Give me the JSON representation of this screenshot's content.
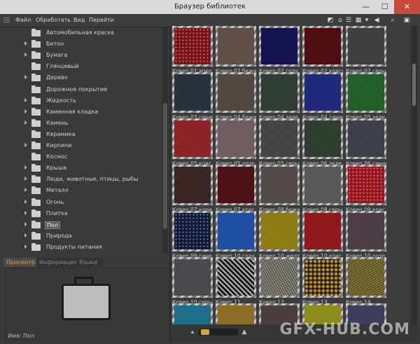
{
  "window": {
    "title": "Браузер библиотек",
    "controls": {
      "minimize": "—",
      "maximize": "☐",
      "close": "✕"
    }
  },
  "menu": [
    "Файл",
    "Обработать",
    "Вид",
    "Перейти"
  ],
  "tree": {
    "items": [
      {
        "label": "Автомобильная краска",
        "arrow": false
      },
      {
        "label": "Бетон",
        "arrow": true
      },
      {
        "label": "Бумага",
        "arrow": true
      },
      {
        "label": "Глянцевый",
        "arrow": false
      },
      {
        "label": "Дерево",
        "arrow": true
      },
      {
        "label": "Дорожное покрытие",
        "arrow": false
      },
      {
        "label": "Жидкость",
        "arrow": true
      },
      {
        "label": "Каменная кладка",
        "arrow": true
      },
      {
        "label": "Камень",
        "arrow": true
      },
      {
        "label": "Керамика",
        "arrow": false
      },
      {
        "label": "Кирпичи",
        "arrow": true
      },
      {
        "label": "Космос",
        "arrow": false
      },
      {
        "label": "Крыша",
        "arrow": true
      },
      {
        "label": "Люди, животные, птицы, рыбы",
        "arrow": true
      },
      {
        "label": "Металл",
        "arrow": true
      },
      {
        "label": "Огонь",
        "arrow": true
      },
      {
        "label": "Плитка",
        "arrow": true
      },
      {
        "label": "Пол",
        "arrow": true,
        "selected": true
      },
      {
        "label": "Природа",
        "arrow": true
      },
      {
        "label": "Продукты питания",
        "arrow": true
      }
    ]
  },
  "tabs": [
    "Просмотр",
    "Информация",
    "Языки"
  ],
  "preview": {
    "name_label": "Имя:",
    "name_value": "Пол"
  },
  "thumbnails": [
    {
      "label": "Ковер 01 арко...",
      "color": "#7a1218",
      "pattern": "dots"
    },
    {
      "label": "Ковер 02 беже...",
      "color": "#5e4d45",
      "pattern": "plain"
    },
    {
      "label": "Ковер 02 голу...",
      "color": "#0e0f4c",
      "pattern": "plain"
    },
    {
      "label": "Ковер 02 красн...",
      "color": "#4a0a0e",
      "pattern": "plain"
    },
    {
      "label": "Ковер 02 серый",
      "color": "#3c3c3c",
      "pattern": "plain"
    },
    {
      "label": "Ковер 03 синий",
      "color": "#252d3b",
      "pattern": "plain"
    },
    {
      "label": "Ковер 04 беже...",
      "color": "#4e453e",
      "pattern": "plain"
    },
    {
      "label": "Ковер 04 зеле...",
      "color": "#2c3a2e",
      "pattern": "plain"
    },
    {
      "label": "Ковер 04 синий",
      "color": "#1c2677",
      "pattern": "plain"
    },
    {
      "label": "Ковер 05 зеле...",
      "color": "#1e5c26",
      "pattern": "plain"
    },
    {
      "label": "Ковер 05 крас...",
      "color": "#8a2024",
      "pattern": "plain"
    },
    {
      "label": "Ковер 05 розо...",
      "color": "#6d5a5a",
      "pattern": "plain"
    },
    {
      "label": "Ковер 05 серый",
      "color": "#414141",
      "pattern": "plain"
    },
    {
      "label": "Ковер 06 зеле...",
      "color": "#2a3a2c",
      "pattern": "plain"
    },
    {
      "label": "Ковер 06 синий",
      "color": "#3a3d45",
      "pattern": "plain"
    },
    {
      "label": "Ковер 07 кори...",
      "color": "#352220",
      "pattern": "plain"
    },
    {
      "label": "Ковер 07 крас...",
      "color": "#4a0d12",
      "pattern": "plain"
    },
    {
      "label": "Ковер 08 беже...",
      "color": "#4f4844",
      "pattern": "plain"
    },
    {
      "label": "Ковер 08 серый",
      "color": "#555555",
      "pattern": "plain"
    },
    {
      "label": "Ковер 09 крас...",
      "color": "#9a1420",
      "pattern": "dots"
    },
    {
      "label": "Ковер 09 сине ...",
      "color": "#101a3a",
      "pattern": "dots"
    },
    {
      "label": "Ковер 10 голу...",
      "color": "#1a4aa0",
      "pattern": "plain"
    },
    {
      "label": "Ковер 10 желт...",
      "color": "#8a7a10",
      "pattern": "plain"
    },
    {
      "label": "Ковер 10 крас...",
      "color": "#8e1418",
      "pattern": "plain"
    },
    {
      "label": "Ковер 10 розо...",
      "color": "#4a3a44",
      "pattern": "plain"
    },
    {
      "label": "Ковер 10 серый",
      "color": "#45454a",
      "pattern": "plain"
    },
    {
      "label": "Ковер 11",
      "color": "#2a2a2a",
      "pattern": "weave"
    },
    {
      "label": "Ковер 12",
      "color": "#6e6a62",
      "pattern": "tweed"
    },
    {
      "label": "Ковер 13",
      "color": "#4a3a1e",
      "pattern": "leopard"
    },
    {
      "label": "Ковер 14",
      "color": "#5a5020",
      "pattern": "lines"
    },
    {
      "label": "",
      "color": "#1a6a8a",
      "pattern": "plain"
    },
    {
      "label": "",
      "color": "#8a6a20",
      "pattern": "plain"
    },
    {
      "label": "",
      "color": "#4a3a3a",
      "pattern": "plain"
    },
    {
      "label": "",
      "color": "#8a8a1a",
      "pattern": "plain"
    },
    {
      "label": "",
      "color": "#3a3a5a",
      "pattern": "plain"
    }
  ],
  "watermark": "GFX-HUB.COM"
}
